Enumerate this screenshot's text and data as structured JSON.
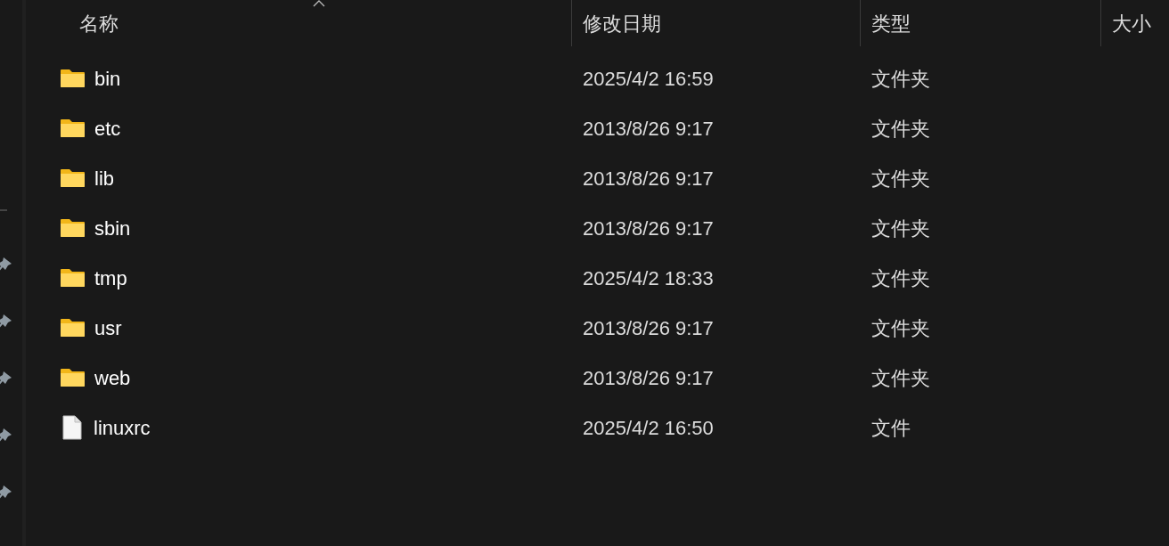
{
  "columns": [
    {
      "label": "名称",
      "sorted": true
    },
    {
      "label": "修改日期",
      "sorted": false
    },
    {
      "label": "类型",
      "sorted": false
    },
    {
      "label": "大小",
      "sorted": false
    }
  ],
  "rows": [
    {
      "kind": "folder",
      "name": "bin",
      "modified": "2025/4/2 16:59",
      "type": "文件夹"
    },
    {
      "kind": "folder",
      "name": "etc",
      "modified": "2013/8/26 9:17",
      "type": "文件夹"
    },
    {
      "kind": "folder",
      "name": "lib",
      "modified": "2013/8/26 9:17",
      "type": "文件夹"
    },
    {
      "kind": "folder",
      "name": "sbin",
      "modified": "2013/8/26 9:17",
      "type": "文件夹"
    },
    {
      "kind": "folder",
      "name": "tmp",
      "modified": "2025/4/2 18:33",
      "type": "文件夹"
    },
    {
      "kind": "folder",
      "name": "usr",
      "modified": "2013/8/26 9:17",
      "type": "文件夹"
    },
    {
      "kind": "folder",
      "name": "web",
      "modified": "2013/8/26 9:17",
      "type": "文件夹"
    },
    {
      "kind": "file",
      "name": "linuxrc",
      "modified": "2025/4/2 16:50",
      "type": "文件"
    }
  ]
}
